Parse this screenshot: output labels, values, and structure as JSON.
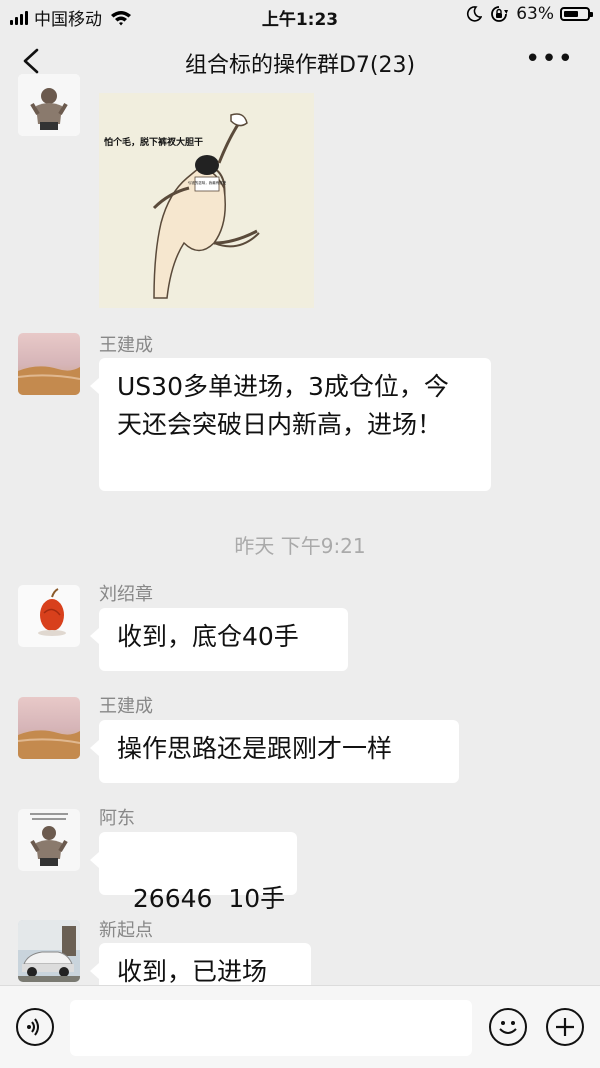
{
  "status_bar": {
    "carrier": "中国移动",
    "time": "上午1:23",
    "battery": "63%",
    "battery_level": 0.63
  },
  "nav": {
    "title": "组合标的操作群D7(23)"
  },
  "sticker": {
    "caption": "怕个毛，脱下裤衩大胆干",
    "sign_text": "亏钱的滋味，我最有感受"
  },
  "messages": [
    {
      "sender": "王建成",
      "text": "US30多单进场，3成仓位，今天还会突破日内新高，进场！"
    },
    {
      "sender": "刘绍章",
      "text": "收到，底仓40手"
    },
    {
      "sender": "王建成",
      "text": "操作思路还是跟刚才一样"
    },
    {
      "sender": "阿东",
      "text": "26646  10手"
    },
    {
      "sender": "新起点",
      "text": "收到，已进场"
    }
  ],
  "timestamp": "昨天 下午9:21",
  "input": {
    "placeholder": ""
  }
}
